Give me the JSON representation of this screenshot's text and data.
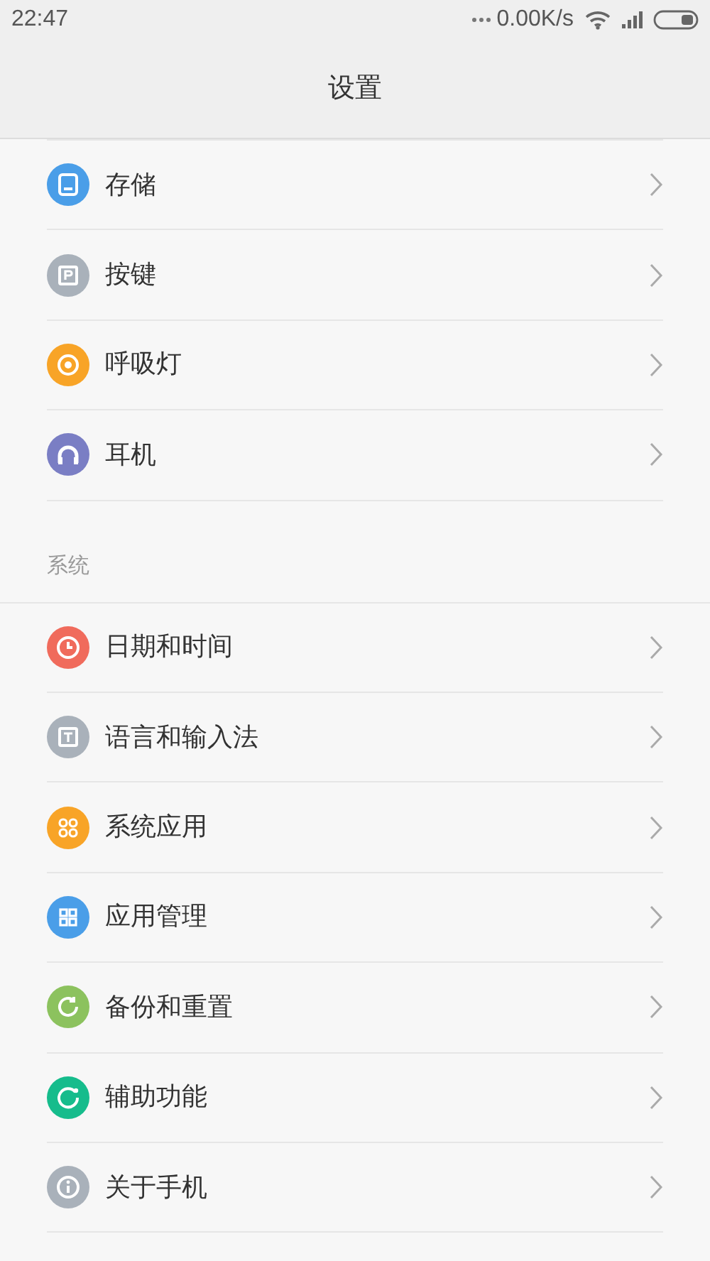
{
  "status_bar": {
    "time": "22:47",
    "speed": "0.00K/s"
  },
  "title": "设置",
  "sections": [
    {
      "items": [
        {
          "label": "存储",
          "kind": "storage",
          "color": "#4a9ee8"
        },
        {
          "label": "按键",
          "kind": "key",
          "color": "#a9b1ba"
        },
        {
          "label": "呼吸灯",
          "kind": "light",
          "color": "#f8a427"
        },
        {
          "label": "耳机",
          "kind": "headphones",
          "color": "#7a7ec4"
        }
      ]
    },
    {
      "header": "系统",
      "items": [
        {
          "label": "日期和时间",
          "kind": "clock",
          "color": "#f06b5c"
        },
        {
          "label": "语言和输入法",
          "kind": "text",
          "color": "#a9b1ba"
        },
        {
          "label": "系统应用",
          "kind": "apps",
          "color": "#f8a427"
        },
        {
          "label": "应用管理",
          "kind": "grid",
          "color": "#4a9ee8"
        },
        {
          "label": "备份和重置",
          "kind": "backup",
          "color": "#8cc25e"
        },
        {
          "label": "辅助功能",
          "kind": "accessibility",
          "color": "#16bc8c"
        },
        {
          "label": "关于手机",
          "kind": "info",
          "color": "#a9b1ba"
        }
      ]
    }
  ]
}
